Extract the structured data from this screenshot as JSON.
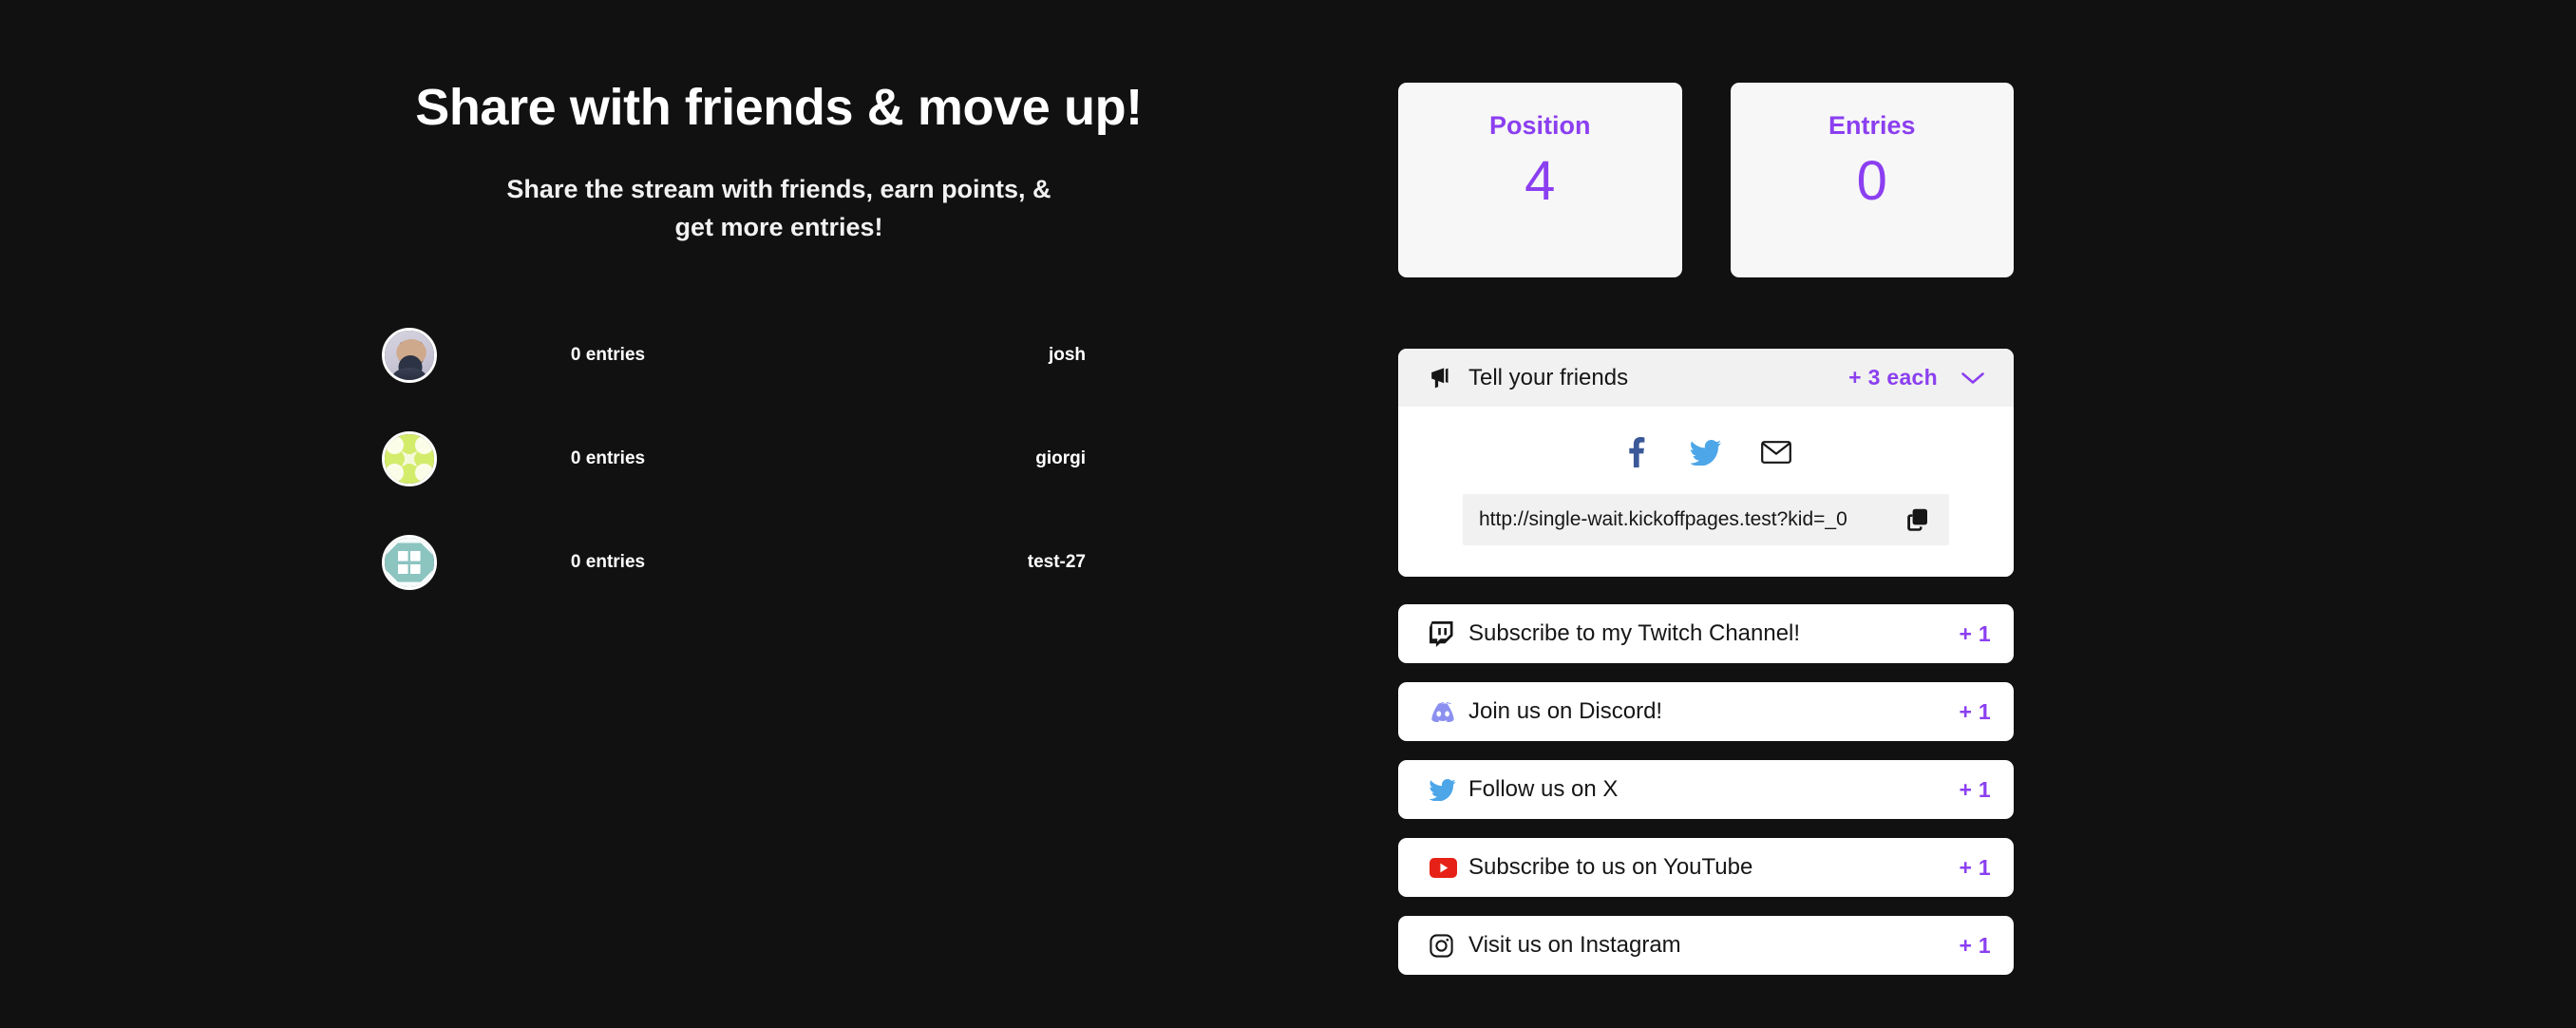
{
  "theme": {
    "background": "#111111",
    "accent_purple": "#8B3FF0",
    "card_background": "#ffffff",
    "stat_card_background": "#f7f7f7",
    "panel_header_background": "#f1f1f1",
    "text_light": "#ffffff",
    "text_dark": "#161616"
  },
  "hero": {
    "headline": "Share with friends & move up!",
    "subheadline": "Share the stream with friends, earn points, & get more entries!"
  },
  "leaderboard": {
    "rows": [
      {
        "avatar": "photo-avatar",
        "entries": "0 entries",
        "name": "josh"
      },
      {
        "avatar": "lime-identicon-avatar",
        "entries": "0 entries",
        "name": "giorgi"
      },
      {
        "avatar": "teal-identicon-avatar",
        "entries": "0 entries",
        "name": "test-27"
      }
    ]
  },
  "stats": [
    {
      "label": "Position",
      "value": "4"
    },
    {
      "label": "Entries",
      "value": "0"
    }
  ],
  "share_panel": {
    "icon": "megaphone-icon",
    "title": "Tell your friends",
    "points": "+ 3 each",
    "chevron": "chevron-down-icon",
    "share_buttons": [
      {
        "icon": "facebook-icon",
        "color": "#3b5998"
      },
      {
        "icon": "twitter-icon",
        "color": "#4da6e8"
      },
      {
        "icon": "email-icon",
        "color": "#161616"
      }
    ],
    "url": "http://single-wait.kickoffpages.test?kid=_0",
    "copy_icon": "copy-icon"
  },
  "actions": [
    {
      "icon": "twitch-icon",
      "label": "Subscribe to my Twitch Channel!",
      "points": "+ 1"
    },
    {
      "icon": "discord-icon",
      "label": "Join us on Discord!",
      "points": "+ 1"
    },
    {
      "icon": "twitter-icon",
      "label": "Follow us on X",
      "points": "+ 1"
    },
    {
      "icon": "youtube-icon",
      "label": "Subscribe to us on YouTube",
      "points": "+ 1"
    },
    {
      "icon": "instagram-icon",
      "label": "Visit us on Instagram",
      "points": "+ 1"
    }
  ]
}
